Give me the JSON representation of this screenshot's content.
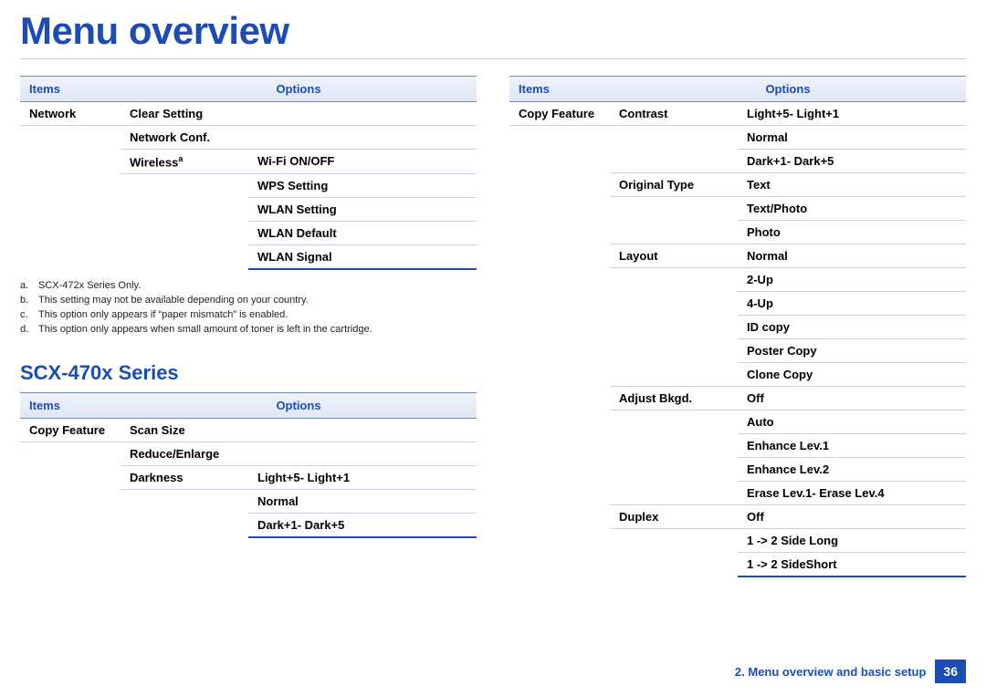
{
  "title": "Menu overview",
  "leftTable1": {
    "head": {
      "items": "Items",
      "options": "Options"
    },
    "rows": [
      {
        "c1": "Network",
        "c2": "Clear Setting",
        "c3": ""
      },
      {
        "c1": "",
        "c2": "Network Conf.",
        "c3": ""
      },
      {
        "c1": "",
        "c2": "Wireless",
        "c2sup": "a",
        "c3": "Wi-Fi ON/OFF"
      },
      {
        "c1": "",
        "c2": "",
        "c3": "WPS Setting"
      },
      {
        "c1": "",
        "c2": "",
        "c3": "WLAN Setting"
      },
      {
        "c1": "",
        "c2": "",
        "c3": "WLAN Default"
      },
      {
        "c1": "",
        "c2": "",
        "c3": "WLAN Signal"
      }
    ]
  },
  "notes": [
    {
      "letter": "a.",
      "text": "SCX-472x Series Only."
    },
    {
      "letter": "b.",
      "text": "This setting may not be available depending on your country."
    },
    {
      "letter": "c.",
      "text": "This option only appears if “paper mismatch” is enabled."
    },
    {
      "letter": "d.",
      "text": "This option only appears when small amount of toner is left in the cartridge."
    }
  ],
  "seriesHeading": "SCX-470x Series",
  "leftTable2": {
    "head": {
      "items": "Items",
      "options": "Options"
    },
    "rows": [
      {
        "c1": "Copy Feature",
        "c2": "Scan Size",
        "c3": ""
      },
      {
        "c1": "",
        "c2": "Reduce/Enlarge",
        "c3": ""
      },
      {
        "c1": "",
        "c2": "Darkness",
        "c3": "Light+5- Light+1"
      },
      {
        "c1": "",
        "c2": "",
        "c3": "Normal"
      },
      {
        "c1": "",
        "c2": "",
        "c3": "Dark+1- Dark+5"
      }
    ]
  },
  "rightTable": {
    "head": {
      "items": "Items",
      "options": "Options"
    },
    "rows": [
      {
        "c1": "Copy Feature",
        "c2": "Contrast",
        "c3": "Light+5- Light+1"
      },
      {
        "c1": "",
        "c2": "",
        "c3": "Normal"
      },
      {
        "c1": "",
        "c2": "",
        "c3": "Dark+1- Dark+5"
      },
      {
        "c1": "",
        "c2": "Original Type",
        "c3": "Text"
      },
      {
        "c1": "",
        "c2": "",
        "c3": "Text/Photo"
      },
      {
        "c1": "",
        "c2": "",
        "c3": "Photo"
      },
      {
        "c1": "",
        "c2": "Layout",
        "c3": "Normal"
      },
      {
        "c1": "",
        "c2": "",
        "c3": "2-Up"
      },
      {
        "c1": "",
        "c2": "",
        "c3": "4-Up"
      },
      {
        "c1": "",
        "c2": "",
        "c3": "ID copy"
      },
      {
        "c1": "",
        "c2": "",
        "c3": "Poster Copy"
      },
      {
        "c1": "",
        "c2": "",
        "c3": "Clone Copy"
      },
      {
        "c1": "",
        "c2": "Adjust Bkgd.",
        "c3": "Off"
      },
      {
        "c1": "",
        "c2": "",
        "c3": "Auto"
      },
      {
        "c1": "",
        "c2": "",
        "c3": "Enhance Lev.1"
      },
      {
        "c1": "",
        "c2": "",
        "c3": "Enhance Lev.2"
      },
      {
        "c1": "",
        "c2": "",
        "c3": "Erase Lev.1- Erase Lev.4"
      },
      {
        "c1": "",
        "c2": "Duplex",
        "c3": "Off"
      },
      {
        "c1": "",
        "c2": "",
        "c3": "1 -> 2 Side Long"
      },
      {
        "c1": "",
        "c2": "",
        "c3": "1 -> 2 SideShort"
      }
    ]
  },
  "footer": {
    "crumb": "2.  Menu overview and basic setup",
    "page": "36"
  }
}
